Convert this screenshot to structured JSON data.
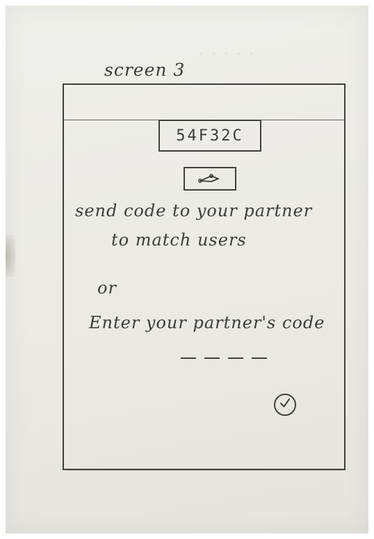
{
  "sketch": {
    "screen_label": "screen 3",
    "partner_code": "54F32C",
    "share_icon": "share-icon",
    "instruction_line1": "send code to your partner",
    "instruction_line2": "to match users",
    "or_text": "or",
    "enter_prompt": "Enter your partner's code",
    "confirm_icon": "checkmark-circle-icon",
    "ink_color": "#3b3b3b",
    "paper_color": "#ecebe6"
  }
}
